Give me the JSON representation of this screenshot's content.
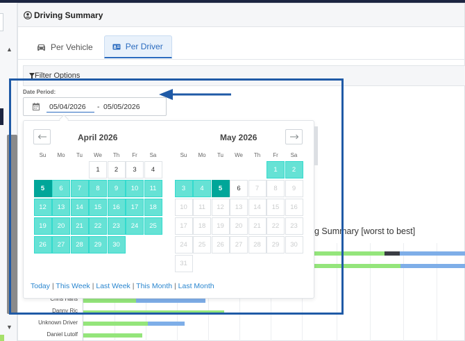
{
  "card": {
    "title": "Driving Summary"
  },
  "tabs": [
    {
      "label": "Per Vehicle"
    },
    {
      "label": "Per Driver"
    }
  ],
  "filter": {
    "label": "Filter Options"
  },
  "date": {
    "label": "Date Period:",
    "start": "05/04/2026",
    "separator": "-",
    "end": "05/05/2026"
  },
  "calendar": {
    "weekdays": [
      "Su",
      "Mo",
      "Tu",
      "We",
      "Th",
      "Fr",
      "Sa"
    ],
    "months": [
      {
        "title": "April 2026",
        "weeks": [
          [
            null,
            null,
            null,
            {
              "d": "1"
            },
            {
              "d": "2"
            },
            {
              "d": "3"
            },
            {
              "d": "4"
            }
          ],
          [
            {
              "d": "5",
              "s": "sel"
            },
            {
              "d": "6",
              "s": "range"
            },
            {
              "d": "7",
              "s": "range"
            },
            {
              "d": "8",
              "s": "range"
            },
            {
              "d": "9",
              "s": "range"
            },
            {
              "d": "10",
              "s": "range"
            },
            {
              "d": "11",
              "s": "range"
            }
          ],
          [
            {
              "d": "12",
              "s": "range"
            },
            {
              "d": "13",
              "s": "range"
            },
            {
              "d": "14",
              "s": "range"
            },
            {
              "d": "15",
              "s": "range"
            },
            {
              "d": "16",
              "s": "range"
            },
            {
              "d": "17",
              "s": "range"
            },
            {
              "d": "18",
              "s": "range"
            }
          ],
          [
            {
              "d": "19",
              "s": "range"
            },
            {
              "d": "20",
              "s": "range"
            },
            {
              "d": "21",
              "s": "range"
            },
            {
              "d": "22",
              "s": "range"
            },
            {
              "d": "23",
              "s": "range"
            },
            {
              "d": "24",
              "s": "range"
            },
            {
              "d": "25",
              "s": "range"
            }
          ],
          [
            {
              "d": "26",
              "s": "range"
            },
            {
              "d": "27",
              "s": "range"
            },
            {
              "d": "28",
              "s": "range"
            },
            {
              "d": "29",
              "s": "range"
            },
            {
              "d": "30",
              "s": "range"
            },
            null,
            null
          ]
        ]
      },
      {
        "title": "May 2026",
        "weeks": [
          [
            null,
            null,
            null,
            null,
            null,
            {
              "d": "1",
              "s": "range"
            },
            {
              "d": "2",
              "s": "range"
            }
          ],
          [
            {
              "d": "3",
              "s": "range"
            },
            {
              "d": "4",
              "s": "range"
            },
            {
              "d": "5",
              "s": "sel"
            },
            {
              "d": "6"
            },
            {
              "d": "7",
              "s": "dis"
            },
            {
              "d": "8",
              "s": "dis"
            },
            {
              "d": "9",
              "s": "dis"
            }
          ],
          [
            {
              "d": "10",
              "s": "dis"
            },
            {
              "d": "11",
              "s": "dis"
            },
            {
              "d": "12",
              "s": "dis"
            },
            {
              "d": "13",
              "s": "dis"
            },
            {
              "d": "14",
              "s": "dis"
            },
            {
              "d": "15",
              "s": "dis"
            },
            {
              "d": "16",
              "s": "dis"
            }
          ],
          [
            {
              "d": "17",
              "s": "dis"
            },
            {
              "d": "18",
              "s": "dis"
            },
            {
              "d": "19",
              "s": "dis"
            },
            {
              "d": "20",
              "s": "dis"
            },
            {
              "d": "21",
              "s": "dis"
            },
            {
              "d": "22",
              "s": "dis"
            },
            {
              "d": "23",
              "s": "dis"
            }
          ],
          [
            {
              "d": "24",
              "s": "dis"
            },
            {
              "d": "25",
              "s": "dis"
            },
            {
              "d": "26",
              "s": "dis"
            },
            {
              "d": "27",
              "s": "dis"
            },
            {
              "d": "28",
              "s": "dis"
            },
            {
              "d": "29",
              "s": "dis"
            },
            {
              "d": "30",
              "s": "dis"
            }
          ],
          [
            {
              "d": "31",
              "s": "dis"
            },
            null,
            null,
            null,
            null,
            null,
            null
          ]
        ]
      }
    ],
    "presets": [
      "Today",
      "This Week",
      "Last Week",
      "This Month",
      "Last Month"
    ],
    "preset_separator": "|"
  },
  "chart": {
    "title_visible": "g Summary [worst to best]",
    "drivers": [
      "Chris Hans",
      "Danny Ric",
      "Unknown Driver",
      "Daniel Lutolf"
    ]
  },
  "colors": {
    "accent": "#2a6bbf",
    "range": "#66e2d5",
    "selected": "#00a699",
    "bar_green": "#94e57b",
    "bar_blue": "#7eaee8",
    "highlight": "#1f5aa6"
  }
}
